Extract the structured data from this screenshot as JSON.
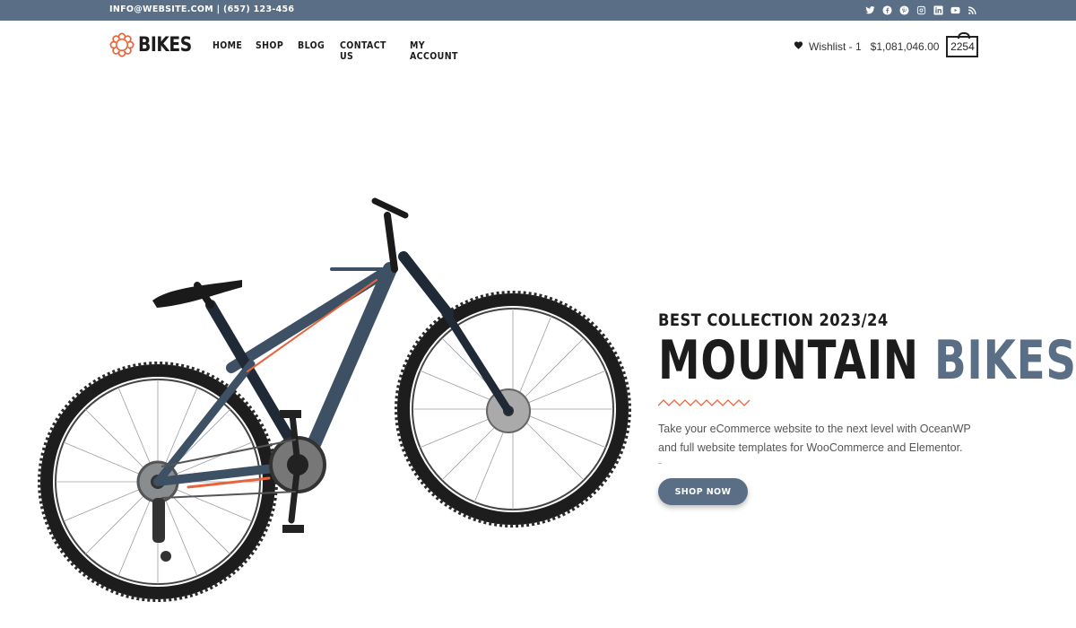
{
  "topbar": {
    "contact": "INFO@WEBSITE.COM | (657) 123-456",
    "social_icons": [
      "twitter-icon",
      "facebook-icon",
      "pinterest-icon",
      "instagram-icon",
      "linkedin-icon",
      "youtube-icon",
      "rss-icon"
    ]
  },
  "header": {
    "logo_text": "BIKES",
    "nav": [
      "HOME",
      "SHOP",
      "BLOG",
      "CONTACT US",
      "MY ACCOUNT"
    ],
    "wishlist": "Wishlist - 1",
    "cart_total": "$1,081,046.00",
    "cart_count": "2254"
  },
  "hero": {
    "subtitle": "BEST COLLECTION 2023/24",
    "title_main": "MOUNTAIN",
    "title_accent": "BIKES",
    "description": "Take your eCommerce website to the next level with OceanWP and full website templates for WooCommerce and Elementor.",
    "button": "SHOP NOW"
  },
  "colors": {
    "accent": "#5a6f85",
    "brand_orange": "#e8643a",
    "text_dark": "#1c1c1c"
  }
}
